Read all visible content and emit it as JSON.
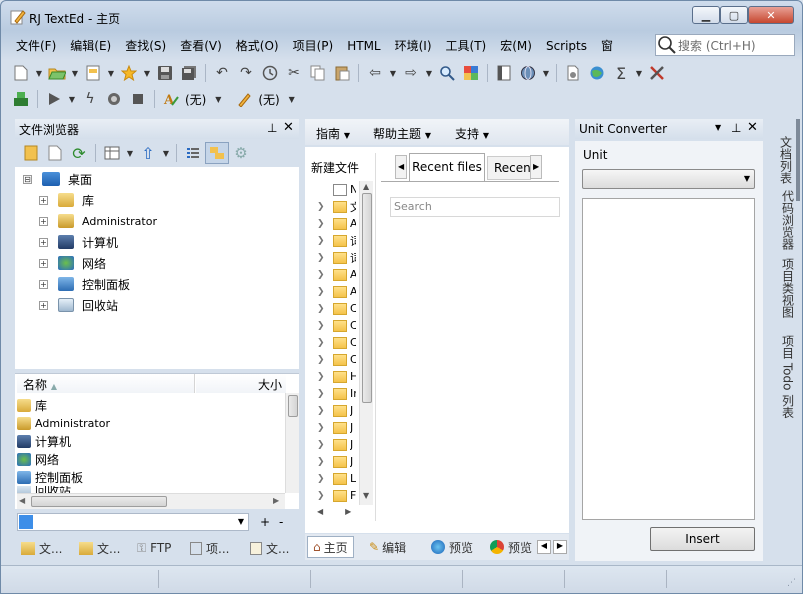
{
  "window": {
    "title": "RJ TextEd - 主页",
    "controls": {
      "minimize": "▁",
      "maximize": "▢",
      "close": "✕"
    }
  },
  "menu": [
    "文件(F)",
    "编辑(E)",
    "查找(S)",
    "查看(V)",
    "格式(O)",
    "项目(P)",
    "HTML",
    "环境(I)",
    "工具(T)",
    "宏(M)",
    "Scripts",
    "窗"
  ],
  "search": {
    "placeholder": "搜索 (Ctrl+H)"
  },
  "toolbar2": {
    "font_style_1": "(无)",
    "font_style_2": "(无)"
  },
  "file_browser": {
    "title": "文件浏览器",
    "tree": [
      {
        "label": "桌面",
        "icon": "desktop-icon",
        "expand": "⊟"
      },
      {
        "label": "库",
        "icon": "library-icon",
        "expand": "+"
      },
      {
        "label": "Administrator",
        "icon": "user-folder-icon",
        "expand": "+"
      },
      {
        "label": "计算机",
        "icon": "computer-icon",
        "expand": "+"
      },
      {
        "label": "网络",
        "icon": "network-icon",
        "expand": "+"
      },
      {
        "label": "控制面板",
        "icon": "control-panel-icon",
        "expand": "+"
      },
      {
        "label": "回收站",
        "icon": "recycle-bin-icon",
        "expand": "+"
      }
    ],
    "list_headers": {
      "name": "名称",
      "size": "大小"
    },
    "list": [
      {
        "label": "库",
        "icon": "library-icon"
      },
      {
        "label": "Administrator",
        "icon": "user-folder-icon"
      },
      {
        "label": "计算机",
        "icon": "computer-icon"
      },
      {
        "label": "网络",
        "icon": "network-icon"
      },
      {
        "label": "控制面板",
        "icon": "control-panel-icon"
      },
      {
        "label": "回收站",
        "icon": "recycle-bin-icon"
      }
    ],
    "bottom_tabs": [
      "文...",
      "文...",
      "FTP",
      "项...",
      "文..."
    ]
  },
  "start_page": {
    "menu": [
      "指南",
      "帮助主题",
      "支持"
    ],
    "new_file": "新建文件",
    "tabs": [
      "Recent files",
      "Recent"
    ],
    "search_placeholder": "Search",
    "folder_initials": [
      "N",
      "文",
      "A",
      "词",
      "词",
      "A",
      "A",
      "C",
      "C",
      "C",
      "C",
      "H",
      "In",
      "J",
      "J",
      "J",
      "J",
      "L",
      "F"
    ]
  },
  "doc_tabs": [
    "主页",
    "编辑",
    "预览",
    "预览"
  ],
  "unit_converter": {
    "title": "Unit Converter",
    "unit_label": "Unit",
    "insert_label": "Insert"
  },
  "side_tabs": [
    "文档列表",
    "代码浏览器",
    "项目类视图",
    "项目 Todo 列表"
  ]
}
